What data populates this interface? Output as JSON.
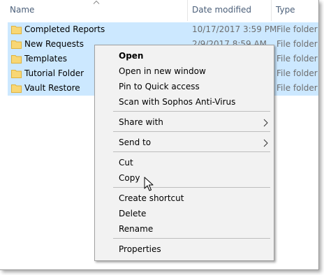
{
  "columns": {
    "name": "Name",
    "date_modified": "Date modified",
    "type": "Type"
  },
  "rows": [
    {
      "name": "Completed Reports",
      "date": "10/17/2017 3:59 PM",
      "type": "File folder"
    },
    {
      "name": "New Requests",
      "date": "2/9/2017 8:59 AM",
      "type": "File folder"
    },
    {
      "name": "Templates",
      "date": "",
      "type": "File folder"
    },
    {
      "name": "Tutorial Folder",
      "date": "",
      "type": "File folder"
    },
    {
      "name": "Vault Restore",
      "date": "",
      "type": "File folder"
    }
  ],
  "context_menu": {
    "open": "Open",
    "open_new_window": "Open in new window",
    "pin_quick_access": "Pin to Quick access",
    "scan_sophos": "Scan with Sophos Anti-Virus",
    "share_with": "Share with",
    "send_to": "Send to",
    "cut": "Cut",
    "copy": "Copy",
    "create_shortcut": "Create shortcut",
    "delete": "Delete",
    "rename": "Rename",
    "properties": "Properties"
  },
  "colors": {
    "selection": "#cce8ff",
    "folder": "#f8d775",
    "menu_bg": "#f2f2f2"
  }
}
